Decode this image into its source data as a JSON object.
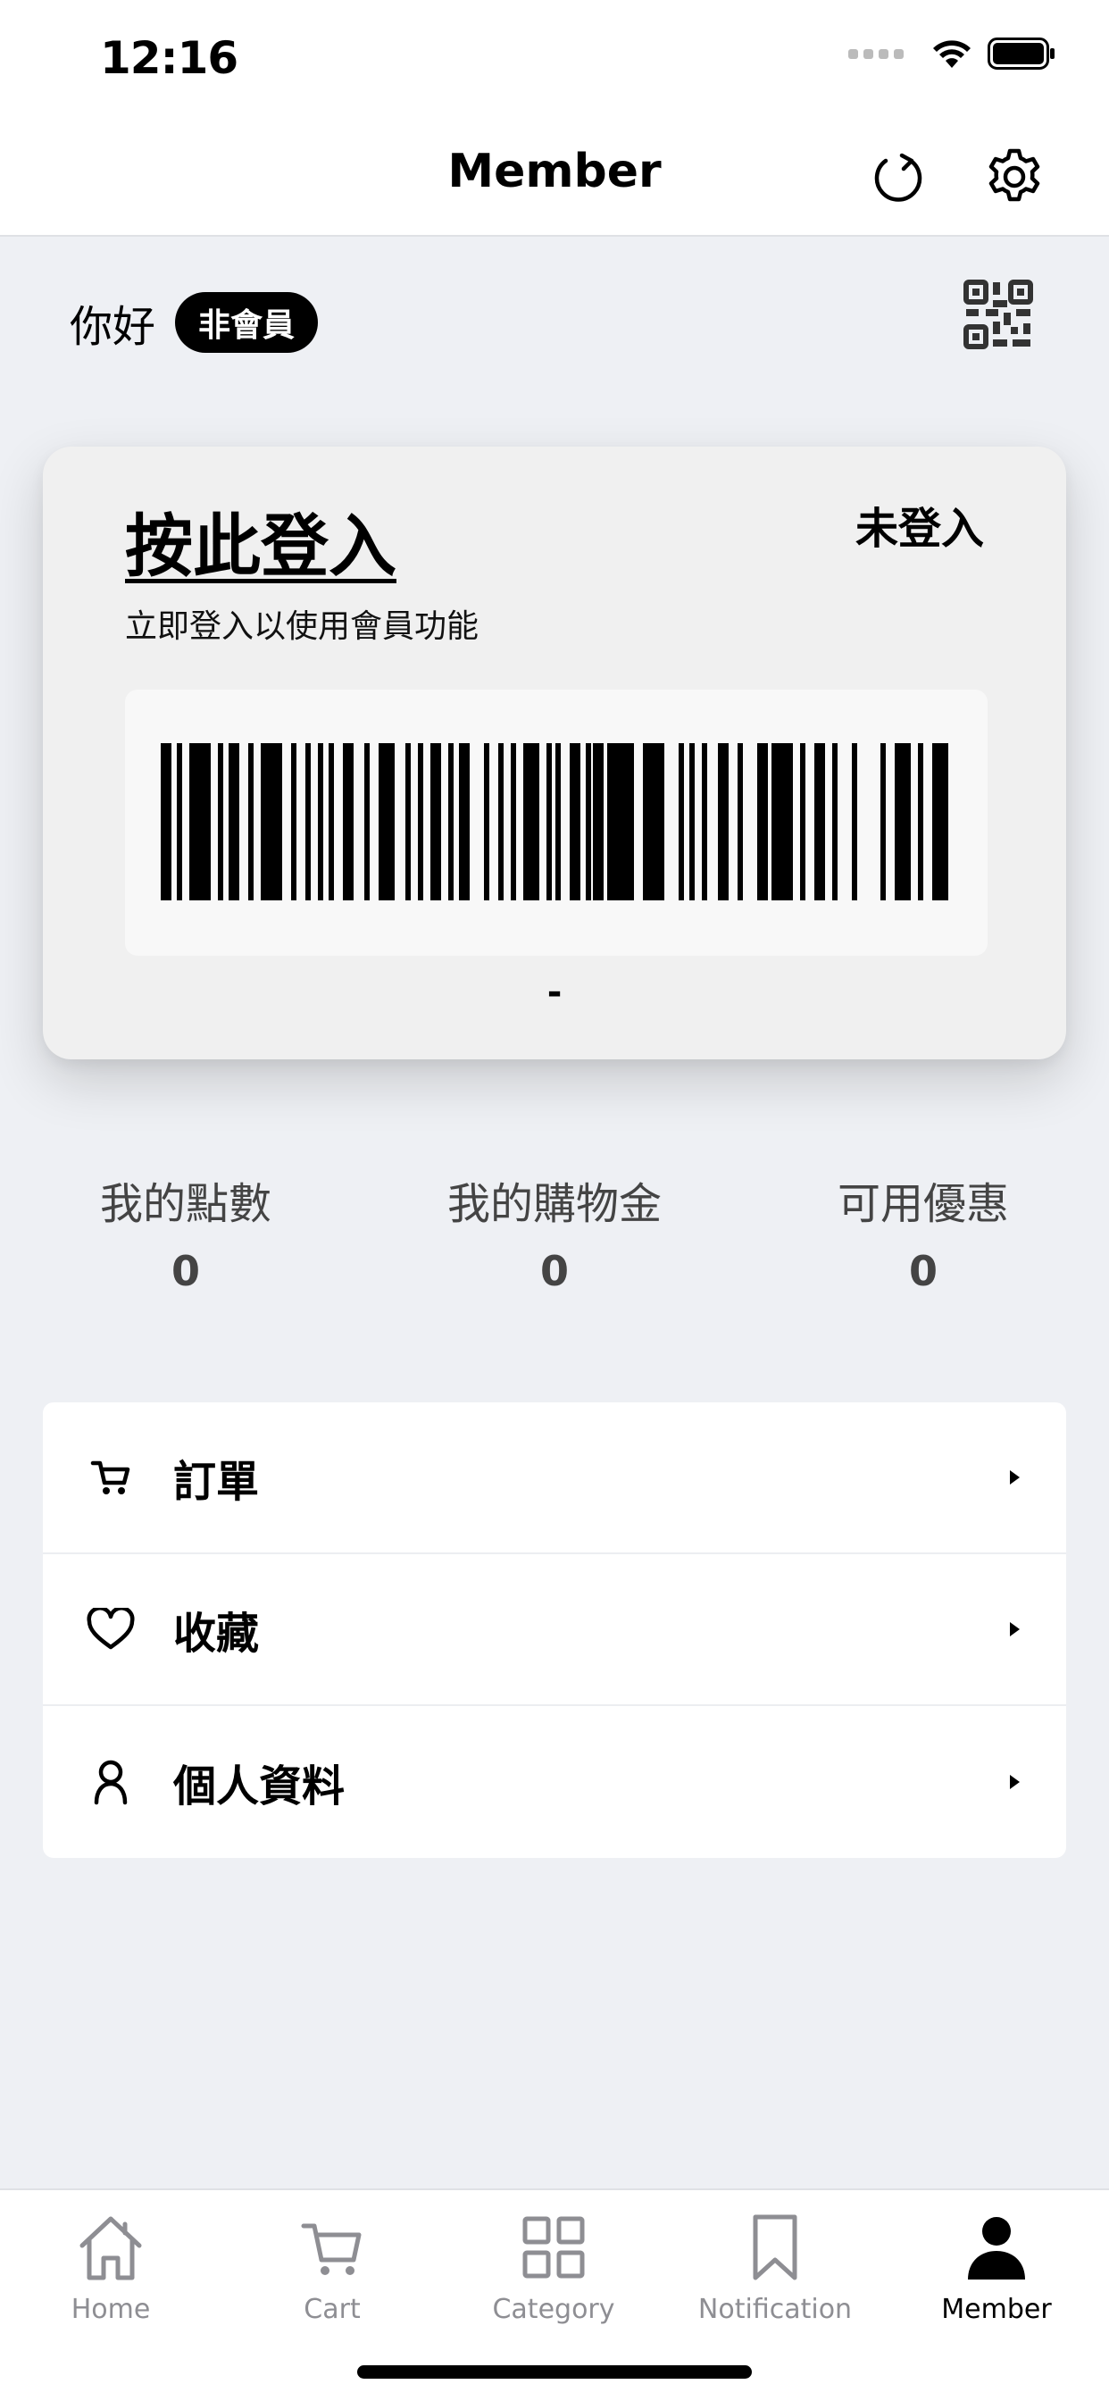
{
  "status_bar": {
    "time": "12:16"
  },
  "nav": {
    "title": "Member",
    "refresh_icon": "refresh-icon",
    "settings_icon": "gear-icon"
  },
  "greeting": {
    "text": "你好",
    "badge": "非會員",
    "qr_icon": "qr-code-icon"
  },
  "card": {
    "login_link": "按此登入",
    "status": "未登入",
    "subtitle": "立即登入以使用會員功能",
    "barcode_number": "-"
  },
  "stats": [
    {
      "label": "我的點數",
      "value": "0"
    },
    {
      "label": "我的購物金",
      "value": "0"
    },
    {
      "label": "可用優惠",
      "value": "0"
    }
  ],
  "menu": [
    {
      "label": "訂單",
      "icon": "cart-icon"
    },
    {
      "label": "收藏",
      "icon": "heart-icon"
    },
    {
      "label": "個人資料",
      "icon": "person-icon"
    }
  ],
  "tabs": [
    {
      "label": "Home",
      "icon": "home-icon",
      "active": false
    },
    {
      "label": "Cart",
      "icon": "cart-icon",
      "active": false
    },
    {
      "label": "Category",
      "icon": "grid-icon",
      "active": false
    },
    {
      "label": "Notification",
      "icon": "bookmark-icon",
      "active": false
    },
    {
      "label": "Member",
      "icon": "person-icon",
      "active": true
    }
  ],
  "colors": {
    "background": "#eef0f4",
    "card": "#f0f0f0",
    "accent": "#000000",
    "inactive_tab": "#8e8e93"
  }
}
